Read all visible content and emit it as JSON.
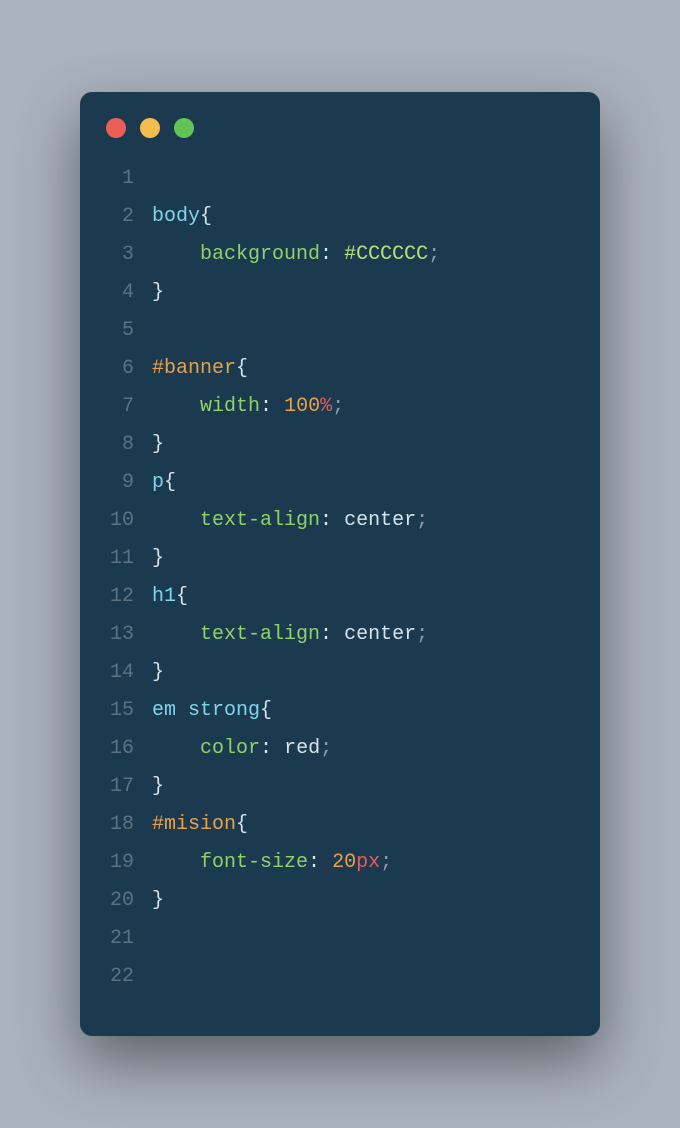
{
  "window": {
    "dots": [
      "red",
      "yellow",
      "green"
    ]
  },
  "lines": {
    "1": {
      "num": "1"
    },
    "2": {
      "num": "2",
      "sel": "body",
      "brace_open": "{"
    },
    "3": {
      "num": "3",
      "prop": "background",
      "colon": ":",
      "hex": "#CCCCCC",
      "semi": ";"
    },
    "4": {
      "num": "4",
      "brace_close": "}"
    },
    "5": {
      "num": "5"
    },
    "6": {
      "num": "6",
      "idsel": "#banner",
      "brace_open": "{"
    },
    "7": {
      "num": "7",
      "prop": "width",
      "colon": ":",
      "numval": "100",
      "unit": "%",
      "semi": ";"
    },
    "8": {
      "num": "8",
      "brace_close": "}"
    },
    "9": {
      "num": "9",
      "sel": "p",
      "brace_open": "{"
    },
    "10": {
      "num": "10",
      "prop": "text-align",
      "colon": ":",
      "valtxt": "center",
      "semi": ";"
    },
    "11": {
      "num": "11",
      "brace_close": "}"
    },
    "12": {
      "num": "12",
      "sel": "h1",
      "brace_open": "{"
    },
    "13": {
      "num": "13",
      "prop": "text-align",
      "colon": ":",
      "valtxt": "center",
      "semi": ";"
    },
    "14": {
      "num": "14",
      "brace_close": "}"
    },
    "15": {
      "num": "15",
      "sel1": "em",
      "sel2": "strong",
      "brace_open": "{"
    },
    "16": {
      "num": "16",
      "prop": "color",
      "colon": ":",
      "valtxt": "red",
      "semi": ";"
    },
    "17": {
      "num": "17",
      "brace_close": "}"
    },
    "18": {
      "num": "18",
      "idsel": "#mision",
      "brace_open": "{"
    },
    "19": {
      "num": "19",
      "prop": "font-size",
      "colon": ":",
      "numval": "20",
      "unit": "px",
      "semi": ";"
    },
    "20": {
      "num": "20",
      "brace_close": "}"
    },
    "21": {
      "num": "21"
    },
    "22": {
      "num": "22"
    }
  }
}
